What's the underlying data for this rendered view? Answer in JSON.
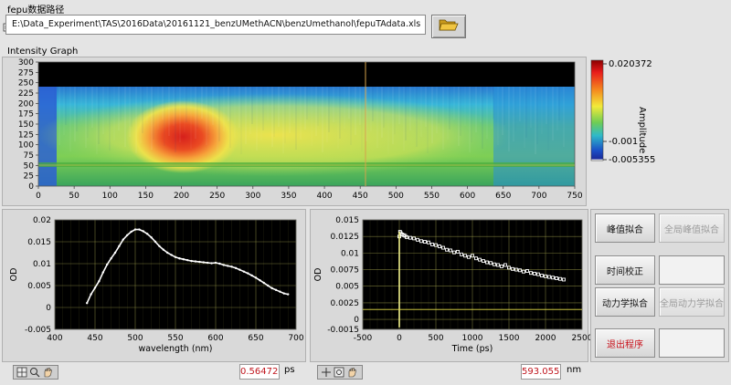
{
  "path_section": {
    "label": "fepu数据路径",
    "path_value": "E:\\Data_Experiment\\TAS\\2016Data\\20161121_benzUMethACN\\benzUmethanol\\fepuTAdata.xls",
    "prefix_icon": "file-path-icon",
    "browse_icon": "folder-open-icon"
  },
  "intensity_graph": {
    "title": "Intensity Graph",
    "y_ticks": [
      "300",
      "275",
      "250",
      "225",
      "200",
      "175",
      "150",
      "125",
      "100",
      "75",
      "50",
      "25",
      "0"
    ],
    "x_ticks": [
      "0",
      "50",
      "100",
      "150",
      "200",
      "250",
      "300",
      "350",
      "400",
      "450",
      "500",
      "550",
      "600",
      "650",
      "700",
      "750"
    ],
    "colorbar": {
      "label": "Amplitude",
      "ticks": [
        "0.020372",
        "-0.001",
        "-0.005355"
      ]
    }
  },
  "chart_data": [
    {
      "type": "line",
      "name": "spectrum-plot",
      "xlabel": "wavelength (nm)",
      "ylabel": "OD",
      "xlim": [
        400,
        700
      ],
      "ylim": [
        -0.005,
        0.02
      ],
      "x_ticks": [
        "400",
        "450",
        "500",
        "550",
        "600",
        "650",
        "700"
      ],
      "y_ticks": [
        "0.02",
        "0.015",
        "0.01",
        "0.005",
        "0",
        "-0.005"
      ],
      "x": [
        440,
        445,
        450,
        455,
        460,
        465,
        470,
        475,
        480,
        485,
        490,
        495,
        500,
        505,
        510,
        515,
        520,
        525,
        530,
        535,
        540,
        545,
        550,
        555,
        560,
        565,
        570,
        575,
        580,
        585,
        590,
        595,
        600,
        605,
        610,
        615,
        620,
        625,
        630,
        635,
        640,
        645,
        650,
        655,
        660,
        665,
        670,
        675,
        680,
        685,
        690
      ],
      "y": [
        0.001,
        0.003,
        0.0045,
        0.006,
        0.008,
        0.0098,
        0.0112,
        0.0125,
        0.014,
        0.0155,
        0.0165,
        0.0173,
        0.0178,
        0.0178,
        0.0174,
        0.0168,
        0.016,
        0.015,
        0.014,
        0.0132,
        0.0125,
        0.012,
        0.0115,
        0.0112,
        0.011,
        0.0108,
        0.0106,
        0.0105,
        0.0104,
        0.0103,
        0.0102,
        0.0101,
        0.0102,
        0.01,
        0.0097,
        0.0095,
        0.0093,
        0.009,
        0.0086,
        0.0082,
        0.0078,
        0.0073,
        0.0068,
        0.0062,
        0.0056,
        0.005,
        0.0044,
        0.004,
        0.0036,
        0.0032,
        0.003
      ]
    },
    {
      "type": "scatter",
      "name": "kinetics-plot",
      "xlabel": "Time (ps)",
      "ylabel": "OD",
      "xlim": [
        -500,
        2500
      ],
      "ylim": [
        -0.0015,
        0.015
      ],
      "x_ticks": [
        "-500",
        "0",
        "500",
        "1000",
        "1500",
        "2000",
        "2500"
      ],
      "y_ticks": [
        "0.015",
        "0.0125",
        "0.01",
        "0.0075",
        "0.005",
        "0.0025",
        "0",
        "-0.0015"
      ],
      "x": [
        0,
        10,
        20,
        40,
        60,
        80,
        100,
        150,
        200,
        250,
        300,
        350,
        400,
        450,
        500,
        550,
        600,
        650,
        700,
        750,
        800,
        850,
        900,
        950,
        1000,
        1050,
        1100,
        1150,
        1200,
        1250,
        1300,
        1350,
        1400,
        1450,
        1500,
        1550,
        1600,
        1650,
        1700,
        1750,
        1800,
        1850,
        1900,
        1950,
        2000,
        2050,
        2100,
        2150,
        2200,
        2250
      ],
      "y": [
        0.0125,
        0.0132,
        0.013,
        0.0128,
        0.0127,
        0.0126,
        0.0124,
        0.0123,
        0.0122,
        0.012,
        0.0118,
        0.0117,
        0.0116,
        0.0113,
        0.0112,
        0.011,
        0.0108,
        0.0105,
        0.0104,
        0.0101,
        0.0102,
        0.0098,
        0.0096,
        0.0094,
        0.0096,
        0.0092,
        0.009,
        0.0088,
        0.0086,
        0.0085,
        0.0083,
        0.0082,
        0.008,
        0.0082,
        0.0078,
        0.0076,
        0.0075,
        0.0074,
        0.0072,
        0.0073,
        0.007,
        0.0069,
        0.0068,
        0.0066,
        0.0065,
        0.0064,
        0.0063,
        0.0062,
        0.0061,
        0.006
      ]
    }
  ],
  "buttons": {
    "peak_fit": "峰值拟合",
    "global_peak_fit": "全局峰值拟合",
    "time_correction": "时间校正",
    "kinetic_fit": "动力学拟合",
    "global_kinetic_fit": "全局动力学拟合",
    "exit": "退出程序"
  },
  "readouts": {
    "time_value": "0.56472",
    "time_unit": "ps",
    "wavelength_value": "593.055",
    "wavelength_unit": "nm"
  },
  "colors": {
    "plot_bg": "#000000",
    "grid": "#9c9c4a",
    "trace": "#ffffff",
    "readout_text": "#c0161e",
    "exit_text": "#c8101a"
  }
}
